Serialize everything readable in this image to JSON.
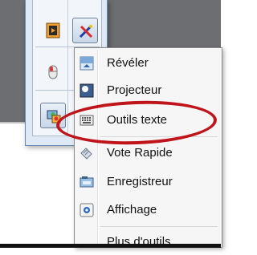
{
  "toolbar": {
    "buttons": [
      {
        "icon": "presentation-icon"
      },
      {
        "icon": "pen-tool-icon"
      },
      {
        "icon": "mouse-icon"
      },
      {
        "icon": "tools-icon"
      }
    ]
  },
  "menu": {
    "items": [
      {
        "label": "Révéler",
        "icon": "reveal-icon"
      },
      {
        "label": "Projecteur",
        "icon": "spotlight-icon"
      },
      {
        "label": "Outils texte",
        "icon": "keyboard-icon"
      },
      {
        "label": "Vote Rapide",
        "icon": "quick-vote-icon"
      },
      {
        "label": "Enregistreur",
        "icon": "recorder-icon"
      },
      {
        "label": "Affichage",
        "icon": "display-icon"
      },
      {
        "label": "Plus d'outils",
        "icon": ""
      }
    ]
  },
  "colors": {
    "background": "#6d6e71",
    "highlight_ring": "#c0141b",
    "toolbar": "#dfe9f5"
  }
}
